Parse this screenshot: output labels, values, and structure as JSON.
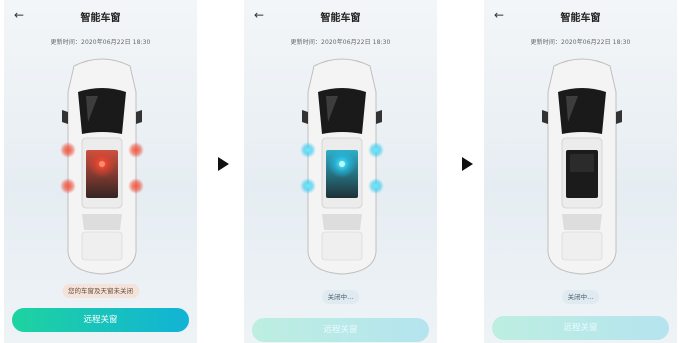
{
  "screens": [
    {
      "back_icon": "back-arrow-icon",
      "title": "智能车窗",
      "update_time": "更新时间：2020年06月22日 18:30",
      "status_text": "您的车窗及天窗未关闭",
      "button_label": "远程关窗",
      "window_state": "open",
      "indicator_color": "#e8402c"
    },
    {
      "back_icon": "back-arrow-icon",
      "title": "智能车窗",
      "update_time": "更新时间：2020年06月22日 18:30",
      "status_text": "关闭中...",
      "button_label": "远程关窗",
      "window_state": "closing",
      "indicator_color": "#1fc4ef"
    },
    {
      "back_icon": "back-arrow-icon",
      "title": "智能车窗",
      "update_time": "更新时间：2020年06月22日 18:30",
      "status_text": "关闭中...",
      "button_label": "远程关窗",
      "window_state": "closed",
      "indicator_color": ""
    }
  ],
  "flow_arrow_icon": "right-arrow-icon",
  "colors": {
    "button_active": "#12c4b8",
    "button_disabled": "#bdeae4",
    "warn_chip": "#f3e3da",
    "info_chip": "#dfeaf1"
  }
}
